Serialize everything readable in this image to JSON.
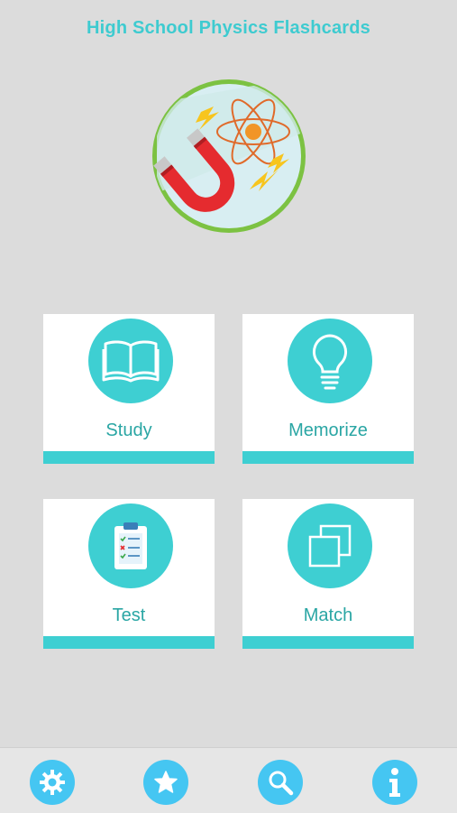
{
  "header": {
    "title": "High School Physics Flashcards"
  },
  "logo": {
    "icon": "physics-magnet-atom-logo"
  },
  "menu": {
    "study": {
      "label": "Study",
      "icon": "book-icon"
    },
    "memorize": {
      "label": "Memorize",
      "icon": "lightbulb-icon"
    },
    "test": {
      "label": "Test",
      "icon": "clipboard-icon"
    },
    "match": {
      "label": "Match",
      "icon": "squares-icon"
    }
  },
  "tabbar": {
    "items": [
      {
        "name": "settings",
        "icon": "gear-icon"
      },
      {
        "name": "favorites",
        "icon": "star-icon"
      },
      {
        "name": "search",
        "icon": "search-icon"
      },
      {
        "name": "info",
        "icon": "info-icon"
      }
    ]
  },
  "colors": {
    "accent": "#3ecfd2",
    "title": "#3ecbd0",
    "label": "#2aa6a4",
    "tab": "#45c6f2",
    "background": "#dcdcdc"
  }
}
